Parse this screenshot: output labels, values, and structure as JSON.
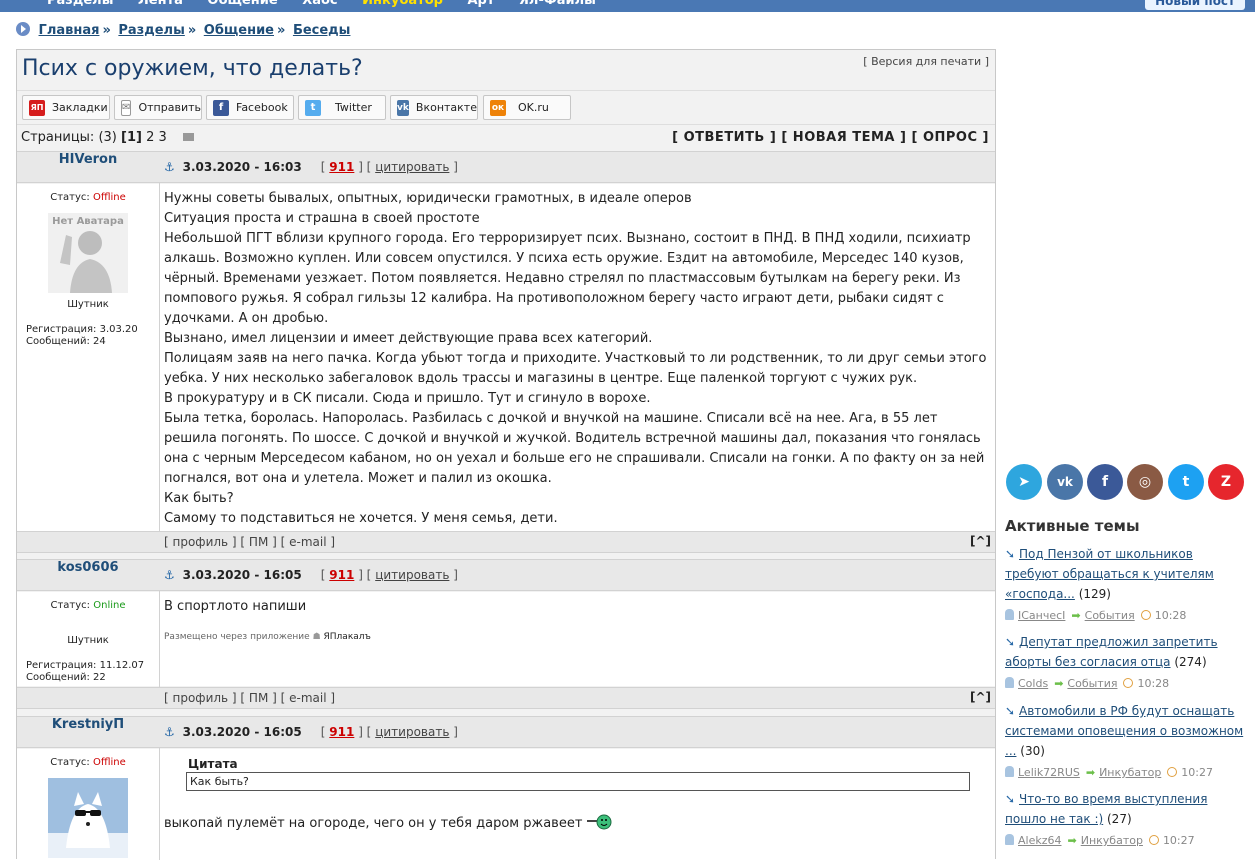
{
  "topnav": {
    "items": [
      "Разделы",
      "Лента",
      "Общение",
      "Хаос",
      "Инкубатор",
      "Арт",
      "Ял-Файлы"
    ],
    "new_post": "Новый пост"
  },
  "breadcrumb": [
    "Главная",
    "Разделы",
    "Общение",
    "Беседы"
  ],
  "topic": {
    "title": "Псих с оружием, что делать?",
    "print_version": "Версия для печати"
  },
  "share": [
    {
      "label": "Закладки",
      "icon": "yandex-bookmarks-icon",
      "color": "#d61d1d",
      "glyph": "ЯП"
    },
    {
      "label": "Отправить",
      "icon": "mail-icon",
      "color": "#888888",
      "glyph": "✉"
    },
    {
      "label": "Facebook",
      "icon": "facebook-icon",
      "color": "#3b5998",
      "glyph": "f"
    },
    {
      "label": "Twitter",
      "icon": "twitter-icon",
      "color": "#55acee",
      "glyph": "t"
    },
    {
      "label": "Вконтакте",
      "icon": "vk-icon",
      "color": "#4a76a8",
      "glyph": "vk"
    },
    {
      "label": "OK.ru",
      "icon": "ok-icon",
      "color": "#ee8208",
      "glyph": "ок"
    }
  ],
  "pages": {
    "label": "Страницы:",
    "count": "(3)",
    "current": "[1]",
    "others": [
      "2",
      "3"
    ]
  },
  "actions": [
    "[ ОТВЕТИТЬ ]",
    "[ НОВАЯ ТЕМА ]",
    "[ ОПРОС ]"
  ],
  "status_label": "Статус:",
  "posts": [
    {
      "author": "HIVeron",
      "status": "Offline",
      "avatar_text": "Нет Аватара",
      "rank": "Шутник",
      "reg": "Регистрация: 3.03.20",
      "msgs": "Сообщений: 24",
      "date": "3.03.2020 - 16:03",
      "num": "911",
      "cite": "цитировать",
      "lines": [
        "Нужны советы бывалых, опытных, юридически грамотных, в идеале оперов",
        "Ситуация проста и страшна в своей простоте",
        "Небольшой ПГТ вблизи крупного города. Его терроризирует псих. Вызнано, состоит в ПНД. В ПНД ходили, психиатр алкашь. Возможно куплен. Или совсем опустился. У психа есть оружие. Ездит на автомобиле, Мерседес 140 кузов, чёрный. Временами уезжает. Потом появляется. Недавно стрелял по пластмассовым бутылкам на берегу реки. Из помпового ружья. Я собрал гильзы 12 калибра. На противоположном берегу часто играют дети, рыбаки сидят с удочками. А он дробью.",
        "Вызнано, имел лицензии и имеет действующие права всех категорий.",
        "Полицаям заяв на него пачка. Когда убьют тогда и приходите. Участковый то ли родственник, то ли друг семьи этого уебка. У них несколько забегаловок вдоль трассы и магазины в центре. Еще паленкой торгуют с чужих рук.",
        "В прокуратуру и в СК писали. Сюда и пришло. Тут и сгинуло в ворохе.",
        "Была тетка, боролась. Напоролась. Разбилась с дочкой и внучкой на машине. Списали всё на нее. Ага, в 55 лет решила погонять. По шоссе. С дочкой и внучкой и жучкой. Водитель встречной машины дал, показания что гонялась она с черным Мерседесом кабаном, но он уехал и больше его не спрашивали. Списали на гонки. А по факту он за ней погнался, вот она и улетела. Может и палил из окошка.",
        "Как быть?",
        "Самому то подставиться не хочется. У меня семья, дети."
      ]
    },
    {
      "author": "kos0606",
      "status": "Online",
      "rank": "Шутник",
      "reg": "Регистрация: 11.12.07",
      "msgs": "Сообщений: 22",
      "date": "3.03.2020 - 16:05",
      "num": "911",
      "cite": "цитировать",
      "text": "В спортлото напиши",
      "via_label": "Размещено через приложение",
      "via_app": "ЯПлакалъ"
    },
    {
      "author": "KrestniyП",
      "status": "Offline",
      "date": "3.03.2020 - 16:05",
      "num": "911",
      "cite": "цитировать",
      "quote_title": "Цитата",
      "quote_text": "Как быть?",
      "text": "выкопай пулемёт на огороде, чего он у тебя даром ржавеет"
    }
  ],
  "footer_links": [
    "профиль",
    "ПМ",
    "e-mail"
  ],
  "to_top": "[^]",
  "socials": [
    {
      "name": "telegram-icon",
      "color": "#2ea6de",
      "glyph": "➤"
    },
    {
      "name": "vk-icon",
      "color": "#4a76a8",
      "glyph": "vk"
    },
    {
      "name": "facebook-icon",
      "color": "#3b5998",
      "glyph": "f"
    },
    {
      "name": "instagram-icon",
      "color": "#8a5a44",
      "glyph": "◎"
    },
    {
      "name": "twitter-icon",
      "color": "#1da1f2",
      "glyph": "t"
    },
    {
      "name": "yaplakal-icon",
      "color": "#e6262d",
      "glyph": "Z"
    }
  ],
  "active_topics": {
    "title": "Активные темы",
    "items": [
      {
        "title": "Под Пензой от школьников требуют обращаться к учителям «господа...",
        "count": "(129)",
        "user": "ICанчесI",
        "section": "События",
        "time": "10:28"
      },
      {
        "title": "Депутат предложил запретить аборты без согласия отца",
        "count": "(274)",
        "user": "Colds",
        "section": "События",
        "time": "10:28"
      },
      {
        "title": "Автомобили в РФ будут оснащать системами оповещения о возможном ...",
        "count": "(30)",
        "user": "Lelik72RUS",
        "section": "Инкубатор",
        "time": "10:27"
      },
      {
        "title": "Что-то во время выступления пошло не так :)",
        "count": "(27)",
        "user": "Alekz64",
        "section": "Инкубатор",
        "time": "10:27"
      }
    ]
  }
}
